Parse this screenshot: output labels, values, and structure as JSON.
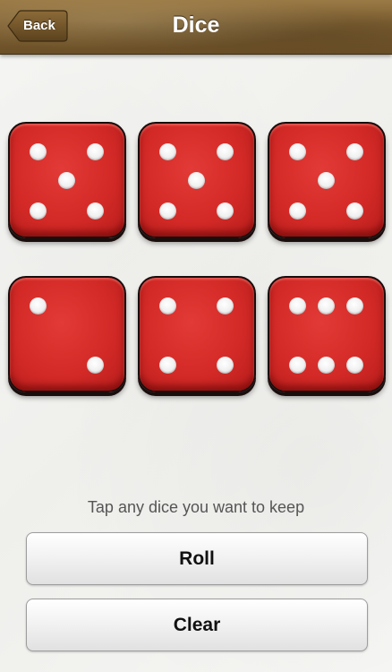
{
  "navbar": {
    "title": "Dice",
    "back_label": "Back"
  },
  "dice": [
    {
      "value": 5
    },
    {
      "value": 5
    },
    {
      "value": 5
    },
    {
      "value": 2
    },
    {
      "value": 4
    },
    {
      "value": 6
    }
  ],
  "hint": "Tap any dice you want to keep",
  "buttons": {
    "roll_label": "Roll",
    "clear_label": "Clear"
  },
  "colors": {
    "die_red": "#d42a27",
    "pip_white": "#ffffff",
    "navbar_brown": "#7d5f31"
  }
}
